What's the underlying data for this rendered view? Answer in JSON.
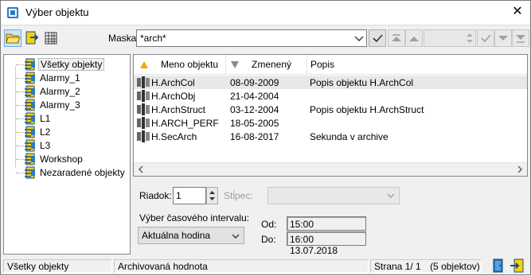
{
  "window": {
    "title": "Výber objektu",
    "close_glyph": "✕"
  },
  "toolbar": {
    "mask_label": "Maska:",
    "mask_value": "*arch*",
    "buttons": [
      "open-folder-icon",
      "export-icon",
      "table-icon"
    ]
  },
  "tree": {
    "items": [
      {
        "label": "Všetky objekty",
        "selected": true
      },
      {
        "label": "Alarmy_1"
      },
      {
        "label": "Alarmy_2"
      },
      {
        "label": "Alarmy_3"
      },
      {
        "label": "L1"
      },
      {
        "label": "L2"
      },
      {
        "label": "L3"
      },
      {
        "label": "Workshop"
      },
      {
        "label": "Nezaradené objekty"
      }
    ]
  },
  "grid": {
    "columns": [
      "Meno objektu",
      "Zmenený",
      "Popis"
    ],
    "sort": {
      "name": "ascending",
      "changed": "descending"
    },
    "rows": [
      {
        "name": "H.ArchCol",
        "changed": "08-09-2009",
        "desc": "Popis objektu H.ArchCol"
      },
      {
        "name": "H.ArchObj",
        "changed": "21-04-2004",
        "desc": ""
      },
      {
        "name": "H.ArchStruct",
        "changed": "03-12-2004",
        "desc": "Popis objektu H.ArchStruct"
      },
      {
        "name": "H.ARCH_PERF",
        "changed": "18-05-2005",
        "desc": ""
      },
      {
        "name": "H.SecArch",
        "changed": "16-08-2017",
        "desc": "Sekunda v archive"
      }
    ]
  },
  "bottom": {
    "riadok_label": "Riadok:",
    "riadok_value": "1",
    "stlpec_label": "Stĺpec:",
    "interval_label": "Výber časového intervalu:",
    "interval_value": "Aktuálna hodina",
    "od_label": "Od:",
    "od_value": "15:00 13.07.2018",
    "do_label": "Do:",
    "do_value": "16:00 13.07.2018"
  },
  "status": {
    "left": "Všetky objekty",
    "middle": "Archivovaná hodnota",
    "page": "Strana  1/ 1",
    "count": "(5 objektov)"
  },
  "colors": {
    "accent": "#1e73be",
    "icon_yellow": "#f4d20c",
    "selection": "#cce4f7"
  }
}
